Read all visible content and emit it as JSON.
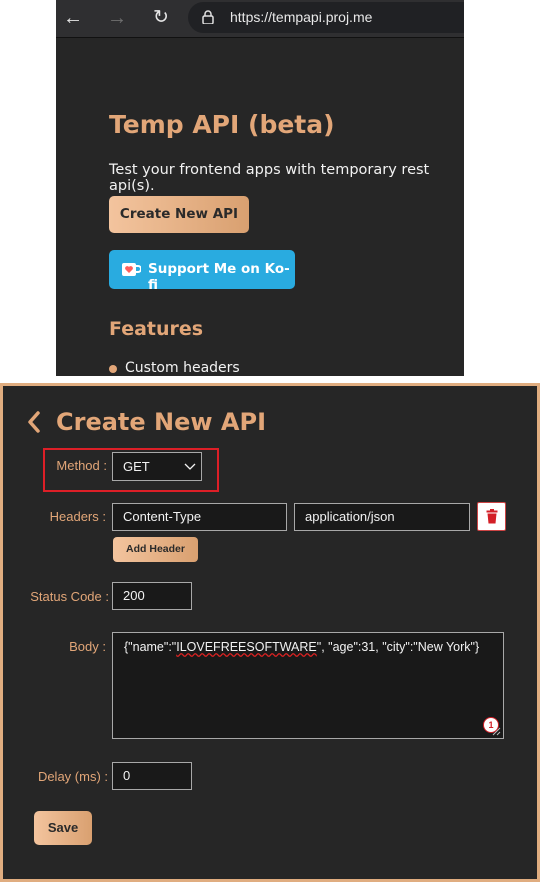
{
  "browser": {
    "url": "https://tempapi.proj.me",
    "back_icon": "←",
    "forward_icon": "→",
    "reload_icon": "↻"
  },
  "landing": {
    "title": "Temp API (beta)",
    "subtitle": "Test your frontend apps with temporary rest api(s).",
    "create_button": "Create New API",
    "kofi_button": "Support Me on Ko-fi",
    "features_heading": "Features",
    "features": [
      "Custom headers"
    ]
  },
  "form": {
    "title": "Create New API",
    "method_label": "Method :",
    "method_value": "GET",
    "headers_label": "Headers :",
    "header_key": "Content-Type",
    "header_value": "application/json",
    "add_header_button": "Add Header",
    "status_label": "Status Code :",
    "status_value": "200",
    "body_label": "Body :",
    "body_prefix": "{\"name\":\"",
    "body_highlight": "ILOVEFREESOFTWARE",
    "body_suffix": "\", \"age\":31, \"city\":\"New York\"}",
    "annotation_badge": "1",
    "delay_label": "Delay (ms) :",
    "delay_value": "0",
    "save_button": "Save"
  },
  "colors": {
    "accent": "#e2a678",
    "background": "#262626",
    "kofi": "#29abe0",
    "highlight_box": "#dd1f27"
  }
}
